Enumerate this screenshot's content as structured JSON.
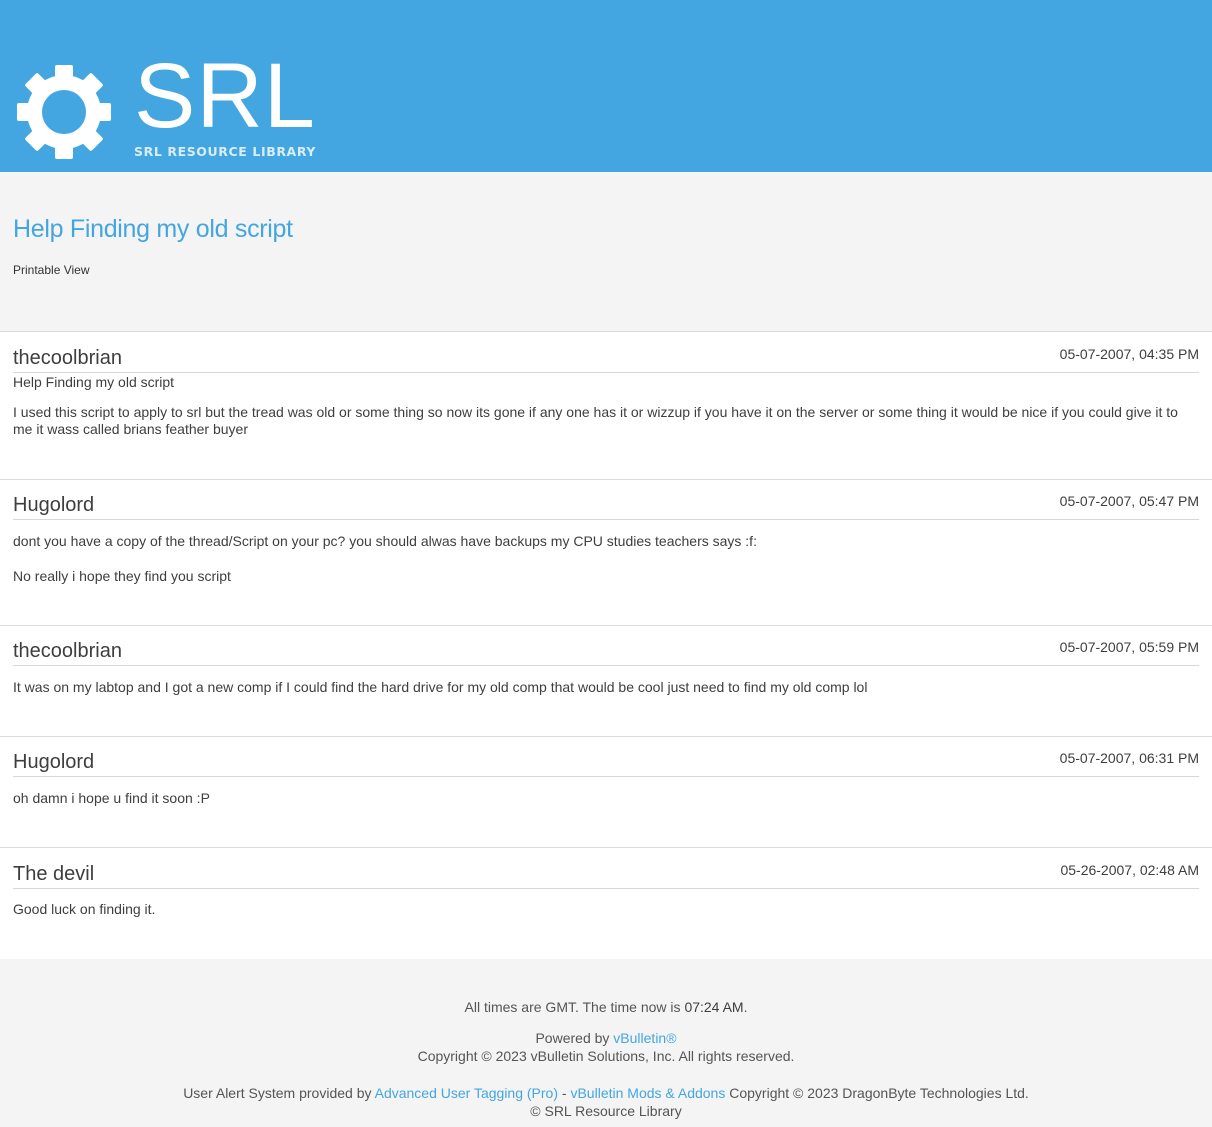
{
  "header": {
    "logo_text": "SRL",
    "logo_subtitle": "SRL RESOURCE LIBRARY",
    "brand_color": "#44a6e0"
  },
  "thread": {
    "title": "Help Finding my old script",
    "printable_view": "Printable View"
  },
  "posts": [
    {
      "username": "thecoolbrian",
      "date": "05-07-2007, 04:35 PM",
      "subject": "Help Finding my old script",
      "body": [
        "I used this script to apply to srl but the tread was old or some thing so now its gone if any one has it or wizzup if you have it on the server or some thing it would be nice if you could give it to me it wass called brians feather buyer"
      ]
    },
    {
      "username": "Hugolord",
      "date": "05-07-2007, 05:47 PM",
      "subject": "",
      "body": [
        "dont you have a copy of the thread/Script on your pc? you should alwas have backups my CPU studies teachers says :f:",
        "No really i hope they find you script"
      ]
    },
    {
      "username": "thecoolbrian",
      "date": "05-07-2007, 05:59 PM",
      "subject": "",
      "body": [
        "It was on my labtop and I got a new comp if I could find the hard drive for my old comp that would be cool just need to find my old comp lol"
      ]
    },
    {
      "username": "Hugolord",
      "date": "05-07-2007, 06:31 PM",
      "subject": "",
      "body": [
        "oh damn i hope u find it soon :P"
      ]
    },
    {
      "username": "The devil",
      "date": "05-26-2007, 02:48 AM",
      "subject": "",
      "body": [
        "Good luck on finding it."
      ]
    }
  ],
  "footer": {
    "times_prefix": "All times are GMT. The time now is ",
    "time_now": "07:24 AM",
    "times_suffix": ".",
    "powered_by": "Powered by ",
    "vbulletin_link": "vBulletin®",
    "copyright_vb": "Copyright © 2023 vBulletin Solutions, Inc. All rights reserved.",
    "alert_prefix": "User Alert System provided by ",
    "aut_link": "Advanced User Tagging (Pro)",
    "dash": " - ",
    "mods_link": "vBulletin Mods & Addons",
    "dragonbyte": " Copyright © 2023 DragonByte Technologies Ltd.",
    "srl_copyright": "© SRL Resource Library"
  }
}
